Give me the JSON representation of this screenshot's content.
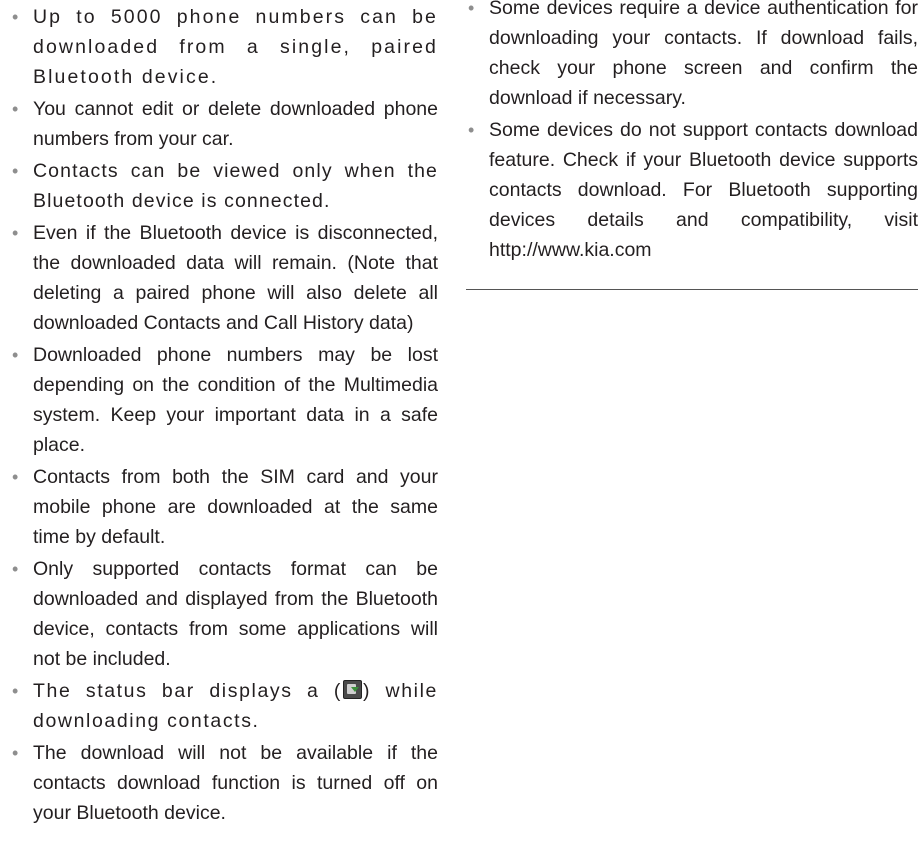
{
  "left_column": {
    "items": [
      {
        "text": "Up to 5000 phone numbers can be downloaded from a single, paired Bluetooth device."
      },
      {
        "text": "You cannot edit or delete downloaded phone numbers from your car."
      },
      {
        "text": "Contacts can be viewed only when the Bluetooth device is connected."
      },
      {
        "text": "Even if the Bluetooth device is disconnected, the downloaded data will remain. (Note that deleting a paired phone will also delete all downloaded Contacts and Call History data)"
      },
      {
        "text": "Downloaded phone numbers may be lost depending on the condition of the Multimedia system. Keep your important data in a safe place."
      },
      {
        "text": "Contacts from both the SIM card and your mobile phone are downloaded at the same time by default."
      },
      {
        "text": "Only supported contacts format can be downloaded and displayed from the Bluetooth device, contacts from some applications will not be included."
      },
      {
        "text_before": "The status bar displays a (",
        "icon": "contacts-download-status-icon",
        "text_after": ") while downloading contacts."
      },
      {
        "text": "The download will not be available if the contacts download function is turned off on your Bluetooth device."
      }
    ]
  },
  "right_column": {
    "items": [
      {
        "text": "Some devices require a device authentication for downloading your contacts. If download fails, check your phone screen and confirm the download if necessary."
      },
      {
        "text": "Some devices do not support contacts download feature. Check if your Bluetooth device supports contacts download. For Bluetooth supporting devices details and compatibility, visit http://www.kia.com"
      }
    ]
  },
  "bullet_symbol": "•",
  "colors": {
    "text": "#231f20",
    "bullet": "#8e8e8e",
    "divider": "#555555"
  }
}
